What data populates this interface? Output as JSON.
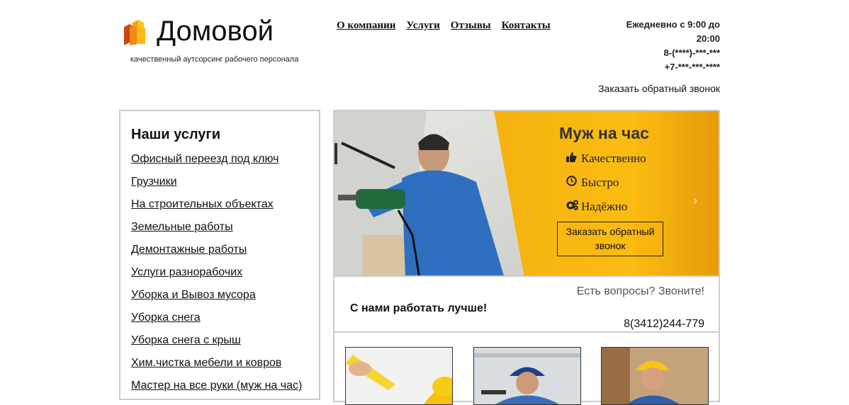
{
  "header": {
    "logo_text": "Домовой",
    "tagline": "качественный аутсорсинг рабочего персонала",
    "nav": [
      "О компании",
      "Услуги",
      "Отзывы",
      "Контакты"
    ],
    "hours": "Ежедневно с 9:00 до 20:00",
    "phone1": "8-(****)-***-***",
    "phone2": "+7-***-***-****",
    "callback": "Заказать обратный звонок"
  },
  "sidebar": {
    "title": "Наши услуги",
    "items": [
      "Офисный переезд под ключ",
      "Грузчики",
      "На строительных объектах",
      "Земельные работы",
      "Демонтажные работы",
      "Услуги разнорабочих",
      "Уборка и Вывоз мусора",
      "Уборка снега",
      "Уборка снега с крыш",
      "Хим.чистка мебели и ковров",
      "Мастер на все руки (муж на час)"
    ]
  },
  "banner": {
    "title": "Муж на час",
    "features": [
      "Качественно",
      "Быстро",
      "Надёжно"
    ],
    "button": "Заказать обратный звонок",
    "next_arrow": "›",
    "accent": "#f5b210"
  },
  "info": {
    "question": "Есть вопросы? Звоните!",
    "lead": "С нами работать лучше!",
    "phone": "8(3412)244-779"
  },
  "icons": {
    "thumbs_up": "thumbs-up-icon",
    "clock": "clock-icon",
    "gears": "gears-icon"
  }
}
